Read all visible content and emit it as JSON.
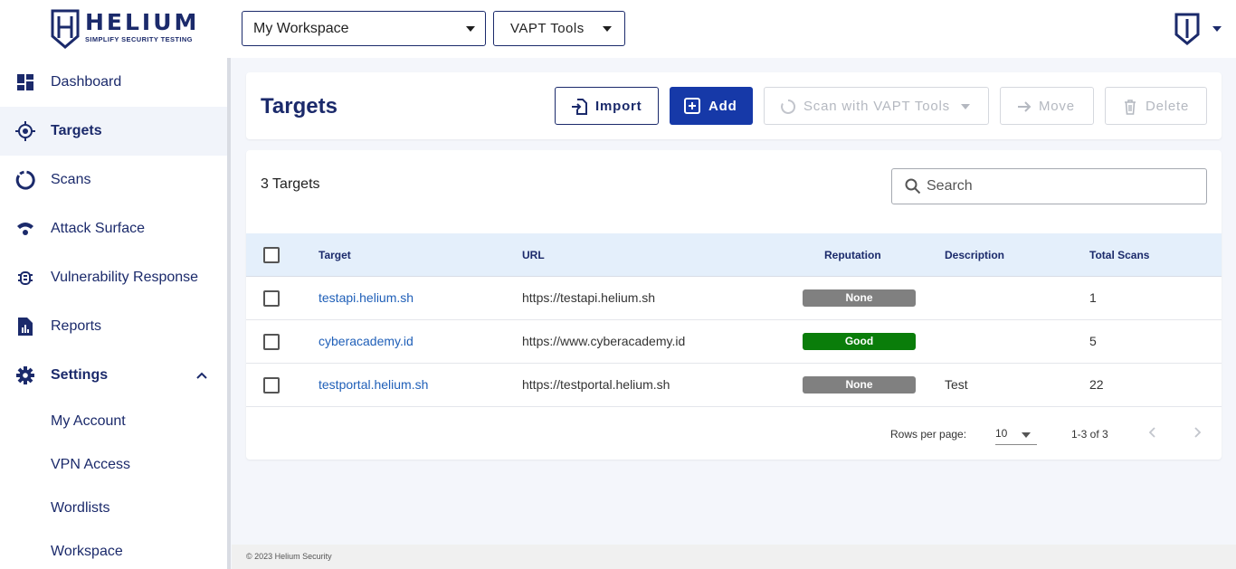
{
  "brand": {
    "name": "HELIUM",
    "tagline": "SIMPLIFY SECURITY TESTING"
  },
  "topbar": {
    "workspace_select": "My Workspace",
    "tools_select": "VAPT Tools",
    "user_icon": "helium-shield-icon"
  },
  "sidebar": {
    "items": [
      {
        "label": "Dashboard",
        "icon": "dashboard-icon"
      },
      {
        "label": "Targets",
        "icon": "target-icon",
        "active": true
      },
      {
        "label": "Scans",
        "icon": "scans-icon"
      },
      {
        "label": "Attack Surface",
        "icon": "attack-surface-icon"
      },
      {
        "label": "Vulnerability Response",
        "icon": "bug-icon"
      },
      {
        "label": "Reports",
        "icon": "reports-icon"
      },
      {
        "label": "Settings",
        "icon": "gear-icon",
        "expanded": true
      }
    ],
    "settings_sub": [
      "My Account",
      "VPN Access",
      "Wordlists",
      "Workspace"
    ]
  },
  "header": {
    "title": "Targets",
    "import_label": "Import",
    "add_label": "Add",
    "scan_label": "Scan with VAPT Tools",
    "move_label": "Move",
    "delete_label": "Delete"
  },
  "table": {
    "count_label": "3 Targets",
    "search_placeholder": "Search",
    "columns": [
      "Target",
      "URL",
      "Reputation",
      "Description",
      "Total Scans"
    ],
    "rows": [
      {
        "target": "testapi.helium.sh",
        "url": "https://testapi.helium.sh",
        "reputation": "None",
        "description": "",
        "total_scans": "1"
      },
      {
        "target": "cyberacademy.id",
        "url": "https://www.cyberacademy.id",
        "reputation": "Good",
        "description": "",
        "total_scans": "5"
      },
      {
        "target": "testportal.helium.sh",
        "url": "https://testportal.helium.sh",
        "reputation": "None",
        "description": "Test",
        "total_scans": "22"
      }
    ],
    "reputation_colors": {
      "None": "#808080",
      "Good": "#0a7d0a"
    }
  },
  "pagination": {
    "rows_per_page_label": "Rows per page:",
    "rows_per_page": "10",
    "range": "1-3 of 3"
  },
  "footer": {
    "copyright": "© 2023 Helium Security"
  },
  "colors": {
    "brand": "#1b2a6b",
    "accent": "#1639a8",
    "link": "#1f5fb8"
  }
}
